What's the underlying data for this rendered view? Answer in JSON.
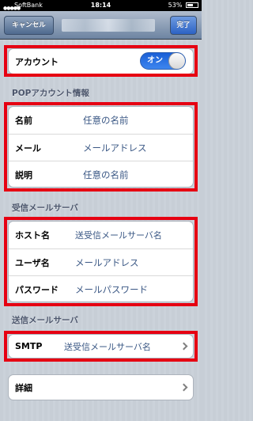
{
  "status_bar": {
    "carrier": "SoftBank",
    "time": "18:14",
    "battery": "53%"
  },
  "nav": {
    "cancel_label": "キャンセル",
    "done_label": "完了"
  },
  "account": {
    "label": "アカウント",
    "toggle_label": "オン"
  },
  "pop_section": {
    "header": "POPアカウント情報",
    "rows": [
      {
        "label": "名前",
        "value": "任意の名前"
      },
      {
        "label": "メール",
        "value": "メールアドレス"
      },
      {
        "label": "説明",
        "value": "任意の名前"
      }
    ]
  },
  "incoming_section": {
    "header": "受信メールサーバ",
    "rows": [
      {
        "label": "ホスト名",
        "value": "送受信メールサーバ名"
      },
      {
        "label": "ユーザ名",
        "value": "メールアドレス"
      },
      {
        "label": "パスワード",
        "value": "メールパスワード"
      }
    ]
  },
  "outgoing_section": {
    "header": "送信メールサーバ",
    "smtp_label": "SMTP",
    "smtp_value": "送受信メールサーバ名"
  },
  "advanced": {
    "label": "詳細"
  },
  "colors": {
    "highlight": "#e60012",
    "value_text": "#3b5885",
    "toggle_on": "#2c6fe0"
  }
}
